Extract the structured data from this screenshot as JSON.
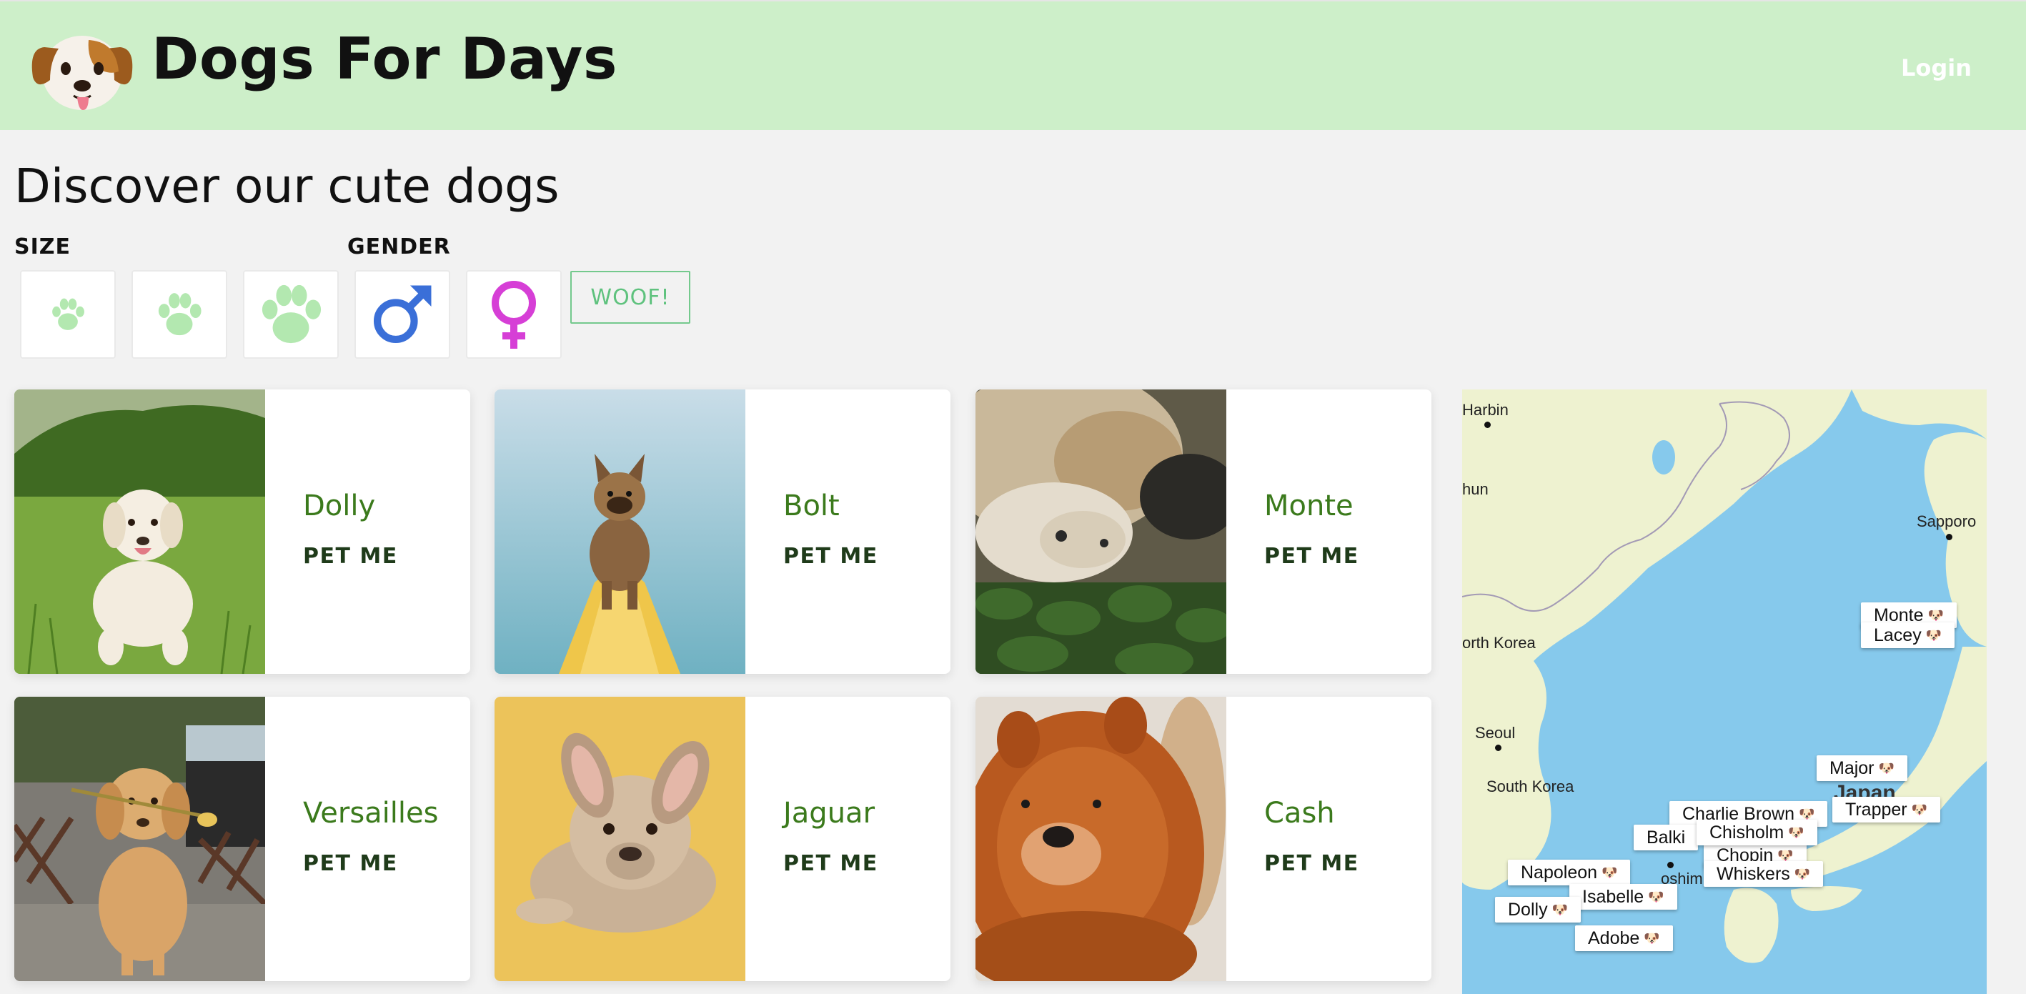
{
  "header": {
    "logo_icon": "dog-face-emoji",
    "title": "Dogs For Days",
    "login_label": "Login"
  },
  "filters": {
    "heading": "Discover our cute dogs",
    "size_label": "SIZE",
    "gender_label": "GENDER",
    "size_options": [
      {
        "icon": "paw-icon-small"
      },
      {
        "icon": "paw-icon-medium"
      },
      {
        "icon": "paw-icon-large"
      }
    ],
    "gender_options": [
      {
        "icon": "male-icon",
        "color": "#3a6fd8"
      },
      {
        "icon": "female-icon",
        "color": "#d63fd6"
      }
    ],
    "woof_label": "WOOF!",
    "accent_color": "#b3e8b0"
  },
  "dogs": [
    {
      "name": "Dolly",
      "action": "PET ME"
    },
    {
      "name": "Bolt",
      "action": "PET ME"
    },
    {
      "name": "Monte",
      "action": "PET ME"
    },
    {
      "name": "Versailles",
      "action": "PET ME"
    },
    {
      "name": "Jaguar",
      "action": "PET ME"
    },
    {
      "name": "Cash",
      "action": "PET ME"
    }
  ],
  "map": {
    "labels": {
      "harbin": "Harbin",
      "chun": "hun",
      "sapporo": "Sapporo",
      "north_korea": "orth Korea",
      "seoul": "Seoul",
      "south_korea": "South Korea",
      "japan": "Japan",
      "hiroshima": "oshim"
    },
    "markers": {
      "monte": "Monte",
      "lacey": "Lacey",
      "major": "Major",
      "charlie_brown": "Charlie Brown",
      "trapper": "Trapper",
      "balki": "Balki",
      "chisholm": "Chisholm",
      "chopin": "Chopin",
      "napoleon": "Napoleon",
      "whiskers": "Whiskers",
      "isabelle": "Isabelle",
      "dolly": "Dolly",
      "adobe": "Adobe"
    },
    "marker_icon": "dog-face-emoji",
    "water_color": "#86c9ec",
    "land_color": "#eef2d0"
  }
}
